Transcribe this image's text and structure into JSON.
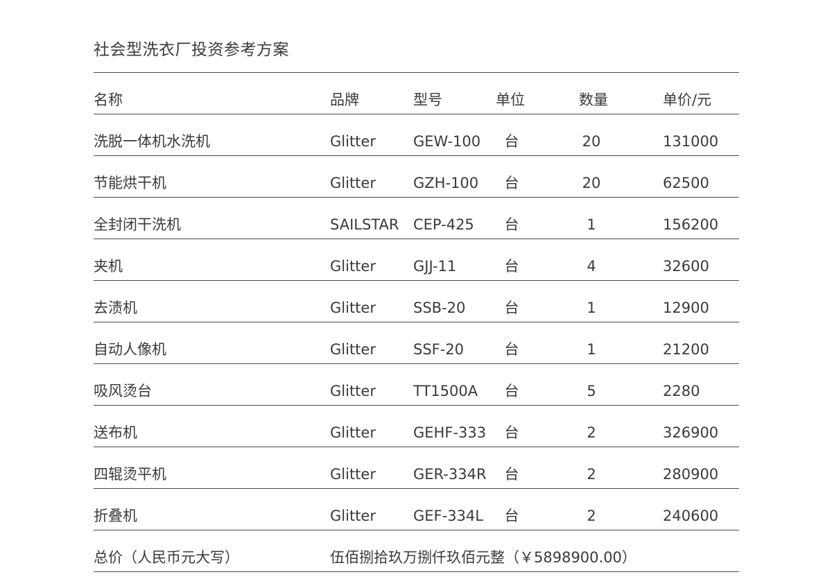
{
  "title": "社会型洗衣厂投资参考方案",
  "headers": {
    "name": "名称",
    "brand": "品牌",
    "model": "型号",
    "unit": "单位",
    "qty": "数量",
    "price": "单价/元"
  },
  "rows": [
    {
      "name": "洗脱一体机水洗机",
      "brand": "Glitter",
      "model": "GEW-100",
      "unit": "台",
      "qty": "20",
      "price": "131000"
    },
    {
      "name": "节能烘干机",
      "brand": "Glitter",
      "model": "GZH-100",
      "unit": "台",
      "qty": "20",
      "price": "62500"
    },
    {
      "name": "全封闭干洗机",
      "brand": "SAILSTAR",
      "model": "CEP-425",
      "unit": "台",
      "qty": "1",
      "price": "156200"
    },
    {
      "name": "夹机",
      "brand": "Glitter",
      "model": "GJJ-11",
      "unit": "台",
      "qty": "4",
      "price": "32600"
    },
    {
      "name": "去渍机",
      "brand": "Glitter",
      "model": "SSB-20",
      "unit": "台",
      "qty": "1",
      "price": "12900"
    },
    {
      "name": "自动人像机",
      "brand": "Glitter",
      "model": "SSF-20",
      "unit": "台",
      "qty": "1",
      "price": "21200"
    },
    {
      "name": "吸风烫台",
      "brand": "Glitter",
      "model": "TT1500A",
      "unit": "台",
      "qty": "5",
      "price": "2280"
    },
    {
      "name": "送布机",
      "brand": "Glitter",
      "model": "GEHF-333",
      "unit": "台",
      "qty": "2",
      "price": "326900"
    },
    {
      "name": "四辊烫平机",
      "brand": "Glitter",
      "model": "GER-334R",
      "unit": "台",
      "qty": "2",
      "price": "280900"
    },
    {
      "name": "折叠机",
      "brand": "Glitter",
      "model": "GEF-334L",
      "unit": "台",
      "qty": "2",
      "price": "240600"
    }
  ],
  "total": {
    "label": "总价（人民币元大写）",
    "value": "伍佰捌拾玖万捌仟玖佰元整（￥5898900.00）"
  }
}
